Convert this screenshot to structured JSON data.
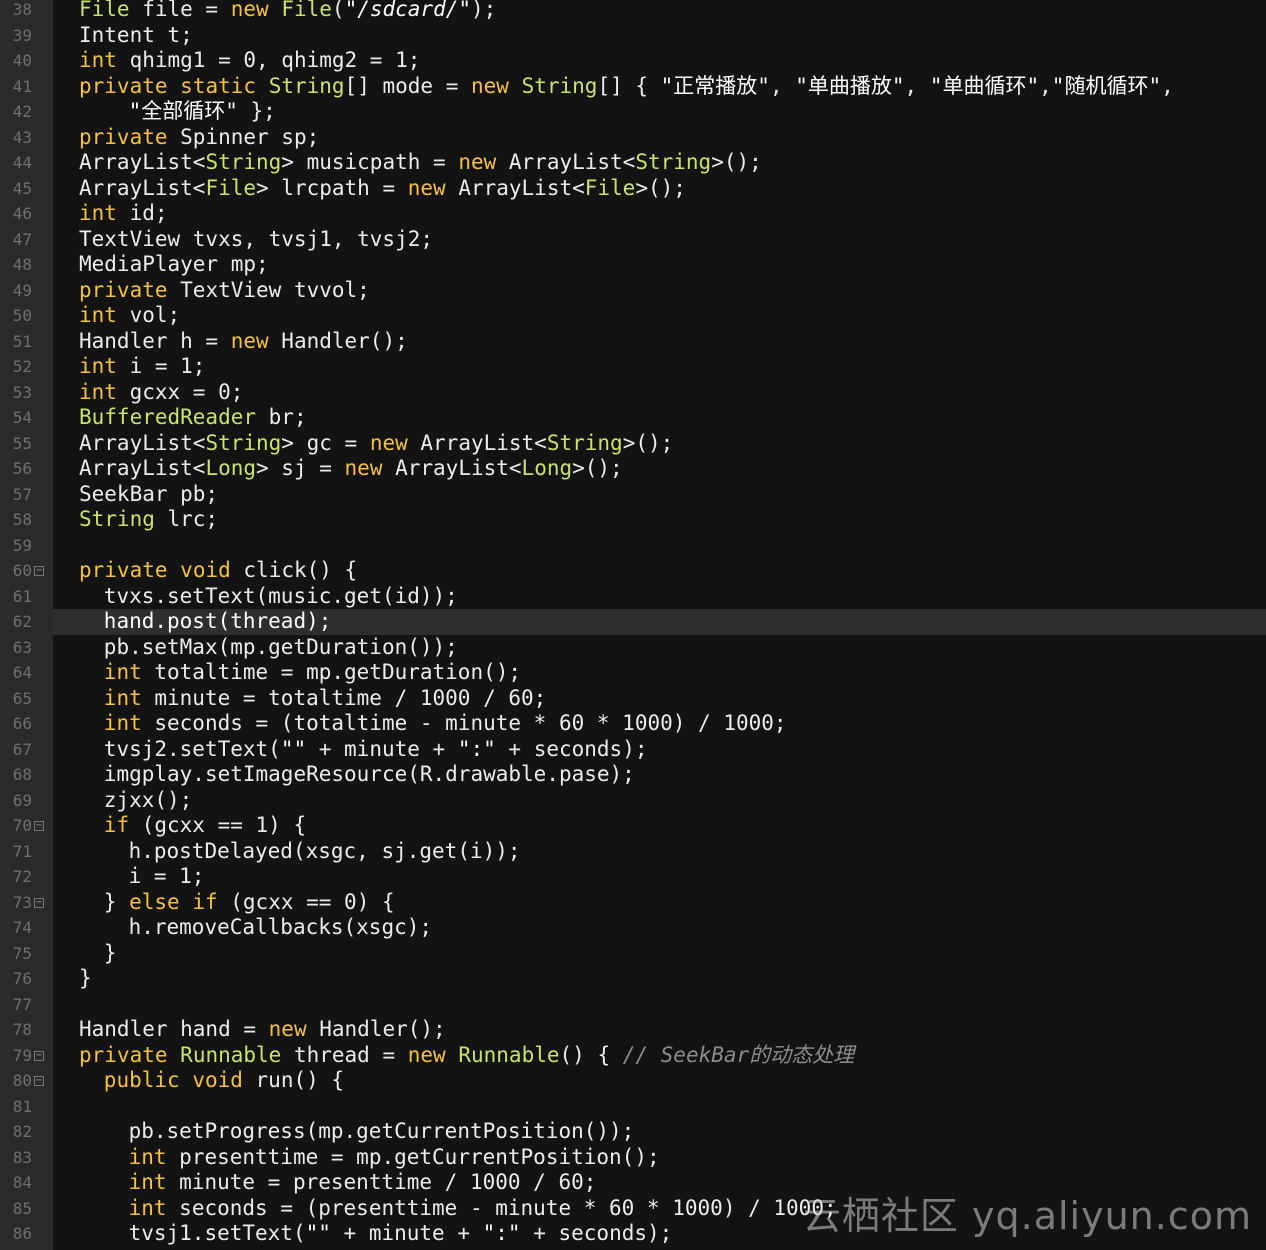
{
  "colors": {
    "background": "#131313",
    "gutter": "#2a2a2a",
    "keyword": "#f5c13f",
    "type": "#c9e46a",
    "string": "#ffffff",
    "comment": "#8c8c8c",
    "plain": "#ececec",
    "line_number": "#6f6f6f"
  },
  "editor": {
    "highlighted_line": "62",
    "fold_markers": [
      "60",
      "70",
      "73",
      "79",
      "80"
    ],
    "lines": [
      {
        "n": "38",
        "indent": 0,
        "tokens": [
          [
            "ty",
            "File"
          ],
          [
            "pl",
            " file = "
          ],
          [
            "kw",
            "new"
          ],
          [
            "pl",
            " "
          ],
          [
            "ty",
            "File"
          ],
          [
            "pl",
            "("
          ],
          [
            "strI",
            "\"/sdcard/\""
          ],
          [
            "pl",
            ");"
          ]
        ]
      },
      {
        "n": "39",
        "indent": 0,
        "tokens": [
          [
            "pl",
            "Intent t;"
          ]
        ]
      },
      {
        "n": "40",
        "indent": 0,
        "tokens": [
          [
            "kw",
            "int"
          ],
          [
            "pl",
            " qhimg1 = 0, qhimg2 = 1;"
          ]
        ]
      },
      {
        "n": "41",
        "indent": 0,
        "tokens": [
          [
            "kw",
            "private"
          ],
          [
            "pl",
            " "
          ],
          [
            "kw",
            "static"
          ],
          [
            "pl",
            " "
          ],
          [
            "ty",
            "String"
          ],
          [
            "pl",
            "[] mode = "
          ],
          [
            "kw",
            "new"
          ],
          [
            "pl",
            " "
          ],
          [
            "ty",
            "String"
          ],
          [
            "pl",
            "[] { "
          ],
          [
            "str",
            "\"正常播放\""
          ],
          [
            "pl",
            ", "
          ],
          [
            "str",
            "\"单曲播放\""
          ],
          [
            "pl",
            ", "
          ],
          [
            "str",
            "\"单曲循环\""
          ],
          [
            "pl",
            ","
          ],
          [
            "str",
            "\"随机循环\""
          ],
          [
            "pl",
            ","
          ]
        ]
      },
      {
        "n": "42",
        "indent": 2,
        "tokens": [
          [
            "str",
            "\"全部循环\""
          ],
          [
            "pl",
            " };"
          ]
        ]
      },
      {
        "n": "43",
        "indent": 0,
        "tokens": [
          [
            "kw",
            "private"
          ],
          [
            "pl",
            " Spinner sp;"
          ]
        ]
      },
      {
        "n": "44",
        "indent": 0,
        "tokens": [
          [
            "pl",
            "ArrayList<"
          ],
          [
            "ty",
            "String"
          ],
          [
            "pl",
            "> musicpath = "
          ],
          [
            "kw",
            "new"
          ],
          [
            "pl",
            " ArrayList<"
          ],
          [
            "ty",
            "String"
          ],
          [
            "pl",
            ">();"
          ]
        ]
      },
      {
        "n": "45",
        "indent": 0,
        "tokens": [
          [
            "pl",
            "ArrayList<"
          ],
          [
            "ty",
            "File"
          ],
          [
            "pl",
            "> lrcpath = "
          ],
          [
            "kw",
            "new"
          ],
          [
            "pl",
            " ArrayList<"
          ],
          [
            "ty",
            "File"
          ],
          [
            "pl",
            ">();"
          ]
        ]
      },
      {
        "n": "46",
        "indent": 0,
        "tokens": [
          [
            "kw",
            "int"
          ],
          [
            "pl",
            " id;"
          ]
        ]
      },
      {
        "n": "47",
        "indent": 0,
        "tokens": [
          [
            "pl",
            "TextView tvxs, tvsj1, tvsj2;"
          ]
        ]
      },
      {
        "n": "48",
        "indent": 0,
        "tokens": [
          [
            "pl",
            "MediaPlayer mp;"
          ]
        ]
      },
      {
        "n": "49",
        "indent": 0,
        "tokens": [
          [
            "kw",
            "private"
          ],
          [
            "pl",
            " TextView tvvol;"
          ]
        ]
      },
      {
        "n": "50",
        "indent": 0,
        "tokens": [
          [
            "kw",
            "int"
          ],
          [
            "pl",
            " vol;"
          ]
        ]
      },
      {
        "n": "51",
        "indent": 0,
        "tokens": [
          [
            "pl",
            "Handler h = "
          ],
          [
            "kw",
            "new"
          ],
          [
            "pl",
            " Handler();"
          ]
        ]
      },
      {
        "n": "52",
        "indent": 0,
        "tokens": [
          [
            "kw",
            "int"
          ],
          [
            "pl",
            " i = 1;"
          ]
        ]
      },
      {
        "n": "53",
        "indent": 0,
        "tokens": [
          [
            "kw",
            "int"
          ],
          [
            "pl",
            " gcxx = 0;"
          ]
        ]
      },
      {
        "n": "54",
        "indent": 0,
        "tokens": [
          [
            "ty",
            "BufferedReader"
          ],
          [
            "pl",
            " br;"
          ]
        ]
      },
      {
        "n": "55",
        "indent": 0,
        "tokens": [
          [
            "pl",
            "ArrayList<"
          ],
          [
            "ty",
            "String"
          ],
          [
            "pl",
            "> gc = "
          ],
          [
            "kw",
            "new"
          ],
          [
            "pl",
            " ArrayList<"
          ],
          [
            "ty",
            "String"
          ],
          [
            "pl",
            ">();"
          ]
        ]
      },
      {
        "n": "56",
        "indent": 0,
        "tokens": [
          [
            "pl",
            "ArrayList<"
          ],
          [
            "ty",
            "Long"
          ],
          [
            "pl",
            "> sj = "
          ],
          [
            "kw",
            "new"
          ],
          [
            "pl",
            " ArrayList<"
          ],
          [
            "ty",
            "Long"
          ],
          [
            "pl",
            ">();"
          ]
        ]
      },
      {
        "n": "57",
        "indent": 0,
        "tokens": [
          [
            "pl",
            "SeekBar pb;"
          ]
        ]
      },
      {
        "n": "58",
        "indent": 0,
        "tokens": [
          [
            "ty",
            "String"
          ],
          [
            "pl",
            " lrc;"
          ]
        ]
      },
      {
        "n": "59",
        "indent": 0,
        "tokens": []
      },
      {
        "n": "60",
        "indent": 0,
        "tokens": [
          [
            "kw",
            "private"
          ],
          [
            "pl",
            " "
          ],
          [
            "kw",
            "void"
          ],
          [
            "pl",
            " click() {"
          ]
        ]
      },
      {
        "n": "61",
        "indent": 1,
        "tokens": [
          [
            "pl",
            "tvxs.setText(music.get(id));"
          ]
        ]
      },
      {
        "n": "62",
        "indent": 1,
        "tokens": [
          [
            "str",
            "hand.post(thread);"
          ]
        ]
      },
      {
        "n": "63",
        "indent": 1,
        "tokens": [
          [
            "pl",
            "pb.setMax(mp.getDuration());"
          ]
        ]
      },
      {
        "n": "64",
        "indent": 1,
        "tokens": [
          [
            "kw",
            "int"
          ],
          [
            "pl",
            " totaltime = mp.getDuration();"
          ]
        ]
      },
      {
        "n": "65",
        "indent": 1,
        "tokens": [
          [
            "kw",
            "int"
          ],
          [
            "pl",
            " minute = totaltime / 1000 / 60;"
          ]
        ]
      },
      {
        "n": "66",
        "indent": 1,
        "tokens": [
          [
            "kw",
            "int"
          ],
          [
            "pl",
            " seconds = (totaltime - minute * 60 * 1000) / 1000;"
          ]
        ]
      },
      {
        "n": "67",
        "indent": 1,
        "tokens": [
          [
            "pl",
            "tvsj2.setText("
          ],
          [
            "str",
            "\"\""
          ],
          [
            "pl",
            " + minute + "
          ],
          [
            "str",
            "\":\""
          ],
          [
            "pl",
            " + seconds);"
          ]
        ]
      },
      {
        "n": "68",
        "indent": 1,
        "tokens": [
          [
            "pl",
            "imgplay.setImageResource(R.drawable.pase);"
          ]
        ]
      },
      {
        "n": "69",
        "indent": 1,
        "tokens": [
          [
            "pl",
            "zjxx();"
          ]
        ]
      },
      {
        "n": "70",
        "indent": 1,
        "tokens": [
          [
            "kw",
            "if"
          ],
          [
            "pl",
            " (gcxx == 1) {"
          ]
        ]
      },
      {
        "n": "71",
        "indent": 2,
        "tokens": [
          [
            "pl",
            "h.postDelayed(xsgc, sj.get(i));"
          ]
        ]
      },
      {
        "n": "72",
        "indent": 2,
        "tokens": [
          [
            "pl",
            "i = 1;"
          ]
        ]
      },
      {
        "n": "73",
        "indent": 1,
        "tokens": [
          [
            "pl",
            "} "
          ],
          [
            "kw",
            "else"
          ],
          [
            "pl",
            " "
          ],
          [
            "kw",
            "if"
          ],
          [
            "pl",
            " (gcxx == 0) {"
          ]
        ]
      },
      {
        "n": "74",
        "indent": 2,
        "tokens": [
          [
            "pl",
            "h.removeCallbacks(xsgc);"
          ]
        ]
      },
      {
        "n": "75",
        "indent": 1,
        "tokens": [
          [
            "pl",
            "}"
          ]
        ]
      },
      {
        "n": "76",
        "indent": 0,
        "tokens": [
          [
            "pl",
            "}"
          ]
        ]
      },
      {
        "n": "77",
        "indent": 0,
        "tokens": []
      },
      {
        "n": "78",
        "indent": 0,
        "tokens": [
          [
            "pl",
            "Handler hand = "
          ],
          [
            "kw",
            "new"
          ],
          [
            "pl",
            " Handler();"
          ]
        ]
      },
      {
        "n": "79",
        "indent": 0,
        "tokens": [
          [
            "kw",
            "private"
          ],
          [
            "pl",
            " "
          ],
          [
            "ty",
            "Runnable"
          ],
          [
            "pl",
            " thread = "
          ],
          [
            "kw",
            "new"
          ],
          [
            "pl",
            " "
          ],
          [
            "ty",
            "Runnable"
          ],
          [
            "pl",
            "() { "
          ],
          [
            "cm",
            "// SeekBar的动态处理"
          ]
        ]
      },
      {
        "n": "80",
        "indent": 1,
        "tokens": [
          [
            "kw",
            "public"
          ],
          [
            "pl",
            " "
          ],
          [
            "kw",
            "void"
          ],
          [
            "pl",
            " run() {"
          ]
        ]
      },
      {
        "n": "81",
        "indent": 0,
        "tokens": []
      },
      {
        "n": "82",
        "indent": 2,
        "tokens": [
          [
            "pl",
            "pb.setProgress(mp.getCurrentPosition());"
          ]
        ]
      },
      {
        "n": "83",
        "indent": 2,
        "tokens": [
          [
            "kw",
            "int"
          ],
          [
            "pl",
            " presenttime = mp.getCurrentPosition();"
          ]
        ]
      },
      {
        "n": "84",
        "indent": 2,
        "tokens": [
          [
            "kw",
            "int"
          ],
          [
            "pl",
            " minute = presenttime / 1000 / 60;"
          ]
        ]
      },
      {
        "n": "85",
        "indent": 2,
        "tokens": [
          [
            "kw",
            "int"
          ],
          [
            "pl",
            " seconds = (presenttime - minute * 60 * 1000) / 1000;"
          ]
        ]
      },
      {
        "n": "86",
        "indent": 2,
        "tokens": [
          [
            "pl",
            "tvsj1.setText("
          ],
          [
            "str",
            "\"\""
          ],
          [
            "pl",
            " + minute + "
          ],
          [
            "str",
            "\":\""
          ],
          [
            "pl",
            " + seconds);"
          ]
        ]
      }
    ]
  },
  "watermark": {
    "text": "云栖社区 yq.aliyun.com"
  }
}
